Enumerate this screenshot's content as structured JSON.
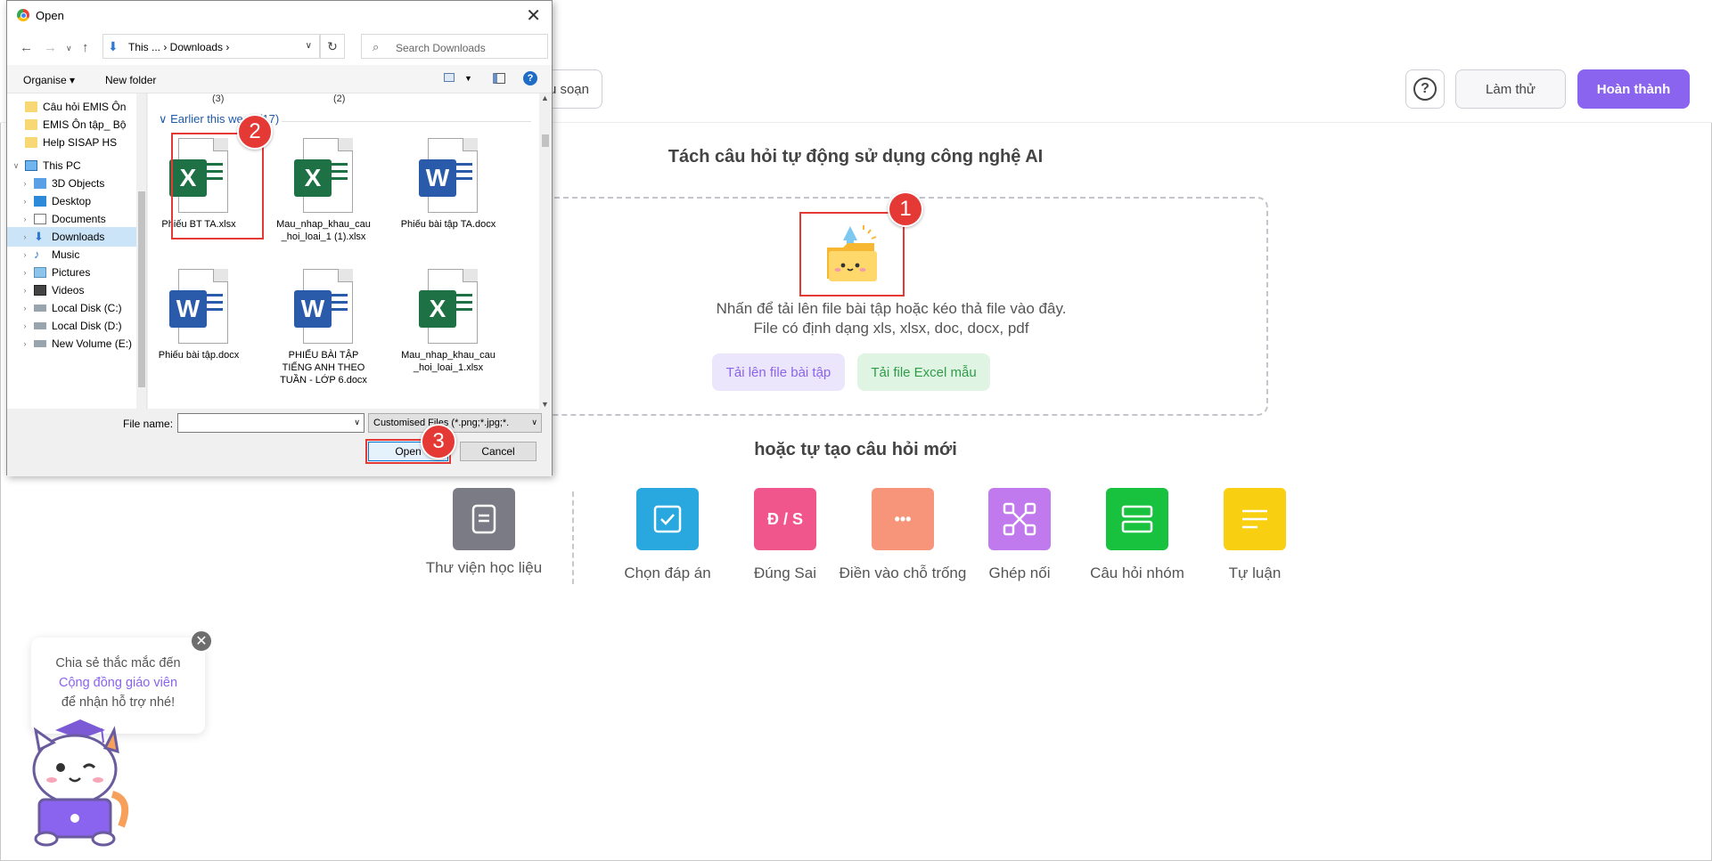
{
  "app": {
    "draft_button": "u soạn",
    "help_button": "?",
    "try_button": "Làm thử",
    "finish_button": "Hoàn thành",
    "ai_title": "Tách câu hỏi tự động sử dụng công nghệ AI",
    "drop_text_line1": "Nhấn để tải lên file bài tập hoặc kéo thả file vào đây.",
    "drop_text_line2": "File có định dạng xls, xlsx, doc, docx, pdf",
    "upload_button": "Tải lên file bài tập",
    "excel_template_button": "Tải file Excel mẫu",
    "or_title": "hoặc tự tạo câu hỏi mới",
    "question_types": [
      {
        "label": "Thư viện học liệu",
        "color": "#7b7b86",
        "icon": "library-icon"
      },
      {
        "label": "Chọn đáp án",
        "color": "#29a8e0",
        "icon": "checkbox-icon"
      },
      {
        "label": "Đúng Sai",
        "color": "#f0568c",
        "icon": "true-false-icon",
        "tile_text": "Đ / S"
      },
      {
        "label": "Điền vào chỗ trống",
        "color": "#f7957a",
        "icon": "ellipsis-icon",
        "tile_text": "•••"
      },
      {
        "label": "Ghép nối",
        "color": "#c17aee",
        "icon": "match-icon"
      },
      {
        "label": "Câu hỏi nhóm",
        "color": "#18c23f",
        "icon": "group-icon"
      },
      {
        "label": "Tự luận",
        "color": "#f9cf12",
        "icon": "essay-icon"
      }
    ],
    "chat": {
      "line1": "Chia sẻ thắc mắc đến",
      "link": "Cộng đồng giáo viên",
      "line3": "để nhận hỗ trợ nhé!",
      "close": "✕"
    },
    "accent_color": "#8a63ee"
  },
  "dialog": {
    "title": "Open",
    "close": "✕",
    "breadcrumb": "This ...  ›  Downloads  ›",
    "search_placeholder": "Search Downloads",
    "organise": "Organise ▾",
    "new_folder": "New folder",
    "tree": [
      {
        "label": "Câu hỏi EMIS Ôn",
        "icon": "folder-icon",
        "expander": ""
      },
      {
        "label": "EMIS Ôn tập_ Bộ",
        "icon": "folder-icon",
        "expander": ""
      },
      {
        "label": "Help SISAP HS",
        "icon": "folder-icon",
        "expander": ""
      },
      {
        "label": "This PC",
        "icon": "pc-icon",
        "expander": "∨"
      },
      {
        "label": "3D Objects",
        "icon": "cube-icon",
        "expander": "›"
      },
      {
        "label": "Desktop",
        "icon": "desktop-icon",
        "expander": "›"
      },
      {
        "label": "Documents",
        "icon": "documents-icon",
        "expander": "›"
      },
      {
        "label": "Downloads",
        "icon": "downloads-icon",
        "expander": "›",
        "selected": true
      },
      {
        "label": "Music",
        "icon": "music-icon",
        "expander": "›"
      },
      {
        "label": "Pictures",
        "icon": "pictures-icon",
        "expander": "›"
      },
      {
        "label": "Videos",
        "icon": "videos-icon",
        "expander": "›"
      },
      {
        "label": "Local Disk (C:)",
        "icon": "drive-icon",
        "expander": "›"
      },
      {
        "label": "Local Disk (D:)",
        "icon": "drive-icon",
        "expander": "›"
      },
      {
        "label": "New Volume (E:)",
        "icon": "drive-icon",
        "expander": "›"
      }
    ],
    "cut_labels": [
      "(3)",
      "(2)"
    ],
    "group_header": "∨  Earlier this week (17)",
    "files": [
      {
        "name": "Phiếu BT TA.xlsx",
        "type": "x"
      },
      {
        "name": "Mau_nhap_khau_cau_hoi_loai_1 (1).xlsx",
        "type": "x"
      },
      {
        "name": "Phiếu bài tập TA.docx",
        "type": "w"
      },
      {
        "name": "Phiếu bài tập.docx",
        "type": "w"
      },
      {
        "name": "PHIẾU BÀI TẬP TIẾNG ANH THEO TUẦN - LỚP 6.docx",
        "type": "w"
      },
      {
        "name": "Mau_nhap_khau_cau_hoi_loai_1.xlsx",
        "type": "x"
      }
    ],
    "file_name_label": "File name:",
    "file_name_value": "",
    "filter": "Customised Files (*.png;*.jpg;*.",
    "open_button": "Open",
    "cancel_button": "Cancel"
  },
  "steps": [
    "1",
    "2",
    "3"
  ]
}
